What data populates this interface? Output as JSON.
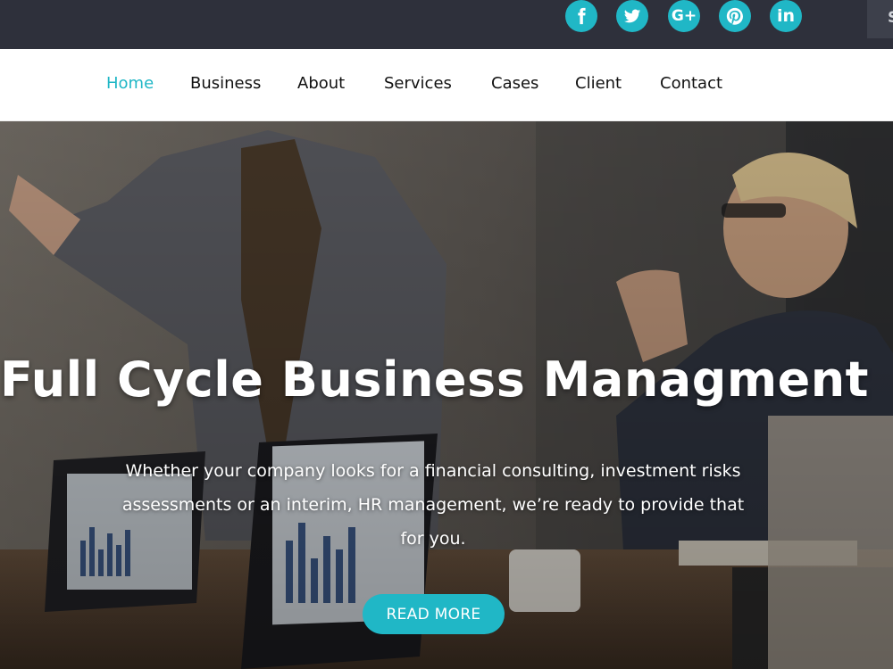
{
  "topbar": {
    "social": [
      {
        "name": "facebook",
        "icon": "facebook-icon"
      },
      {
        "name": "twitter",
        "icon": "twitter-icon"
      },
      {
        "name": "google-plus",
        "icon": "google-plus-icon",
        "glyph": "G+"
      },
      {
        "name": "pinterest",
        "icon": "pinterest-icon"
      },
      {
        "name": "linkedin",
        "icon": "linkedin-icon",
        "glyph": "in"
      }
    ],
    "search_tab_label": "S"
  },
  "nav": {
    "items": [
      {
        "label": "Home",
        "active": true
      },
      {
        "label": "Business"
      },
      {
        "label": "About"
      },
      {
        "label": "Services"
      },
      {
        "label": "Cases"
      },
      {
        "label": "Client"
      },
      {
        "label": "Contact"
      }
    ]
  },
  "hero": {
    "title": "Full Cycle Business Managment",
    "description": "Whether your company looks for a financial consulting, investment risks assessments or an interim, HR management, we’re ready to provide that for you.",
    "cta_label": "READ MORE"
  },
  "colors": {
    "accent": "#20b7c6",
    "topbar_bg": "#2e303b",
    "nav_text": "#111111"
  }
}
